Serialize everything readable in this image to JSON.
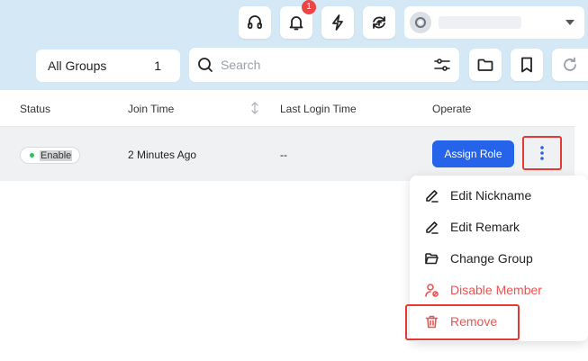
{
  "topbar": {
    "notification_count": "1",
    "icons": [
      "headset-icon",
      "bell-icon",
      "lightning-icon",
      "sync-icon"
    ]
  },
  "account": {
    "avatar_icon": "user-avatar-icon",
    "caret_icon": "caret-down-icon"
  },
  "toolbar": {
    "group_label": "All Groups",
    "group_count": "1",
    "search_placeholder": "Search",
    "icons": [
      "filter-icon",
      "folder-icon",
      "bookmark-icon",
      "refresh-icon"
    ]
  },
  "table": {
    "columns": {
      "status": "Status",
      "join_time": "Join Time",
      "last_login": "Last Login Time",
      "operate": "Operate"
    },
    "rows": [
      {
        "status": "Enable",
        "join_time": "2 Minutes Ago",
        "last_login": "--",
        "assign_label": "Assign Role"
      }
    ]
  },
  "menu": {
    "items": [
      {
        "label": "Edit Nickname",
        "icon": "edit-icon"
      },
      {
        "label": "Edit Remark",
        "icon": "edit-icon"
      },
      {
        "label": "Change Group",
        "icon": "folder-open-icon"
      },
      {
        "label": "Disable Member",
        "icon": "user-disable-icon"
      },
      {
        "label": "Remove",
        "icon": "trash-icon"
      }
    ]
  },
  "colors": {
    "accent": "#2563eb",
    "danger": "#ef5350",
    "highlight": "#e53935",
    "status_ok": "#22c55e",
    "background": "#d5e8f5"
  }
}
